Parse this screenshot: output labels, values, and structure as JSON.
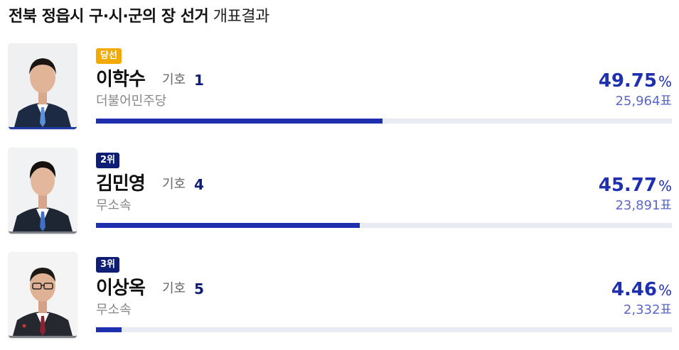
{
  "header": {
    "title_strong": "전북 정읍시 구·시·군의 장 선거",
    "title_light": "개표결과"
  },
  "candidates": [
    {
      "badge": "당선",
      "name": "이학수",
      "number_label": "기호",
      "number": "1",
      "party": "더불어민주당",
      "percent": "49.75",
      "percent_unit": "%",
      "votes": "25,964표",
      "share": 49.75
    },
    {
      "badge": "2위",
      "name": "김민영",
      "number_label": "기호",
      "number": "4",
      "party": "무소속",
      "percent": "45.77",
      "percent_unit": "%",
      "votes": "23,891표",
      "share": 45.77
    },
    {
      "badge": "3위",
      "name": "이상옥",
      "number_label": "기호",
      "number": "5",
      "party": "무소속",
      "percent": "4.46",
      "percent_unit": "%",
      "votes": "2,332표",
      "share": 4.46
    }
  ],
  "colors": {
    "accent": "#1e2fb0",
    "winner_badge": "#f2a900",
    "rank_badge": "#0e1d75"
  }
}
